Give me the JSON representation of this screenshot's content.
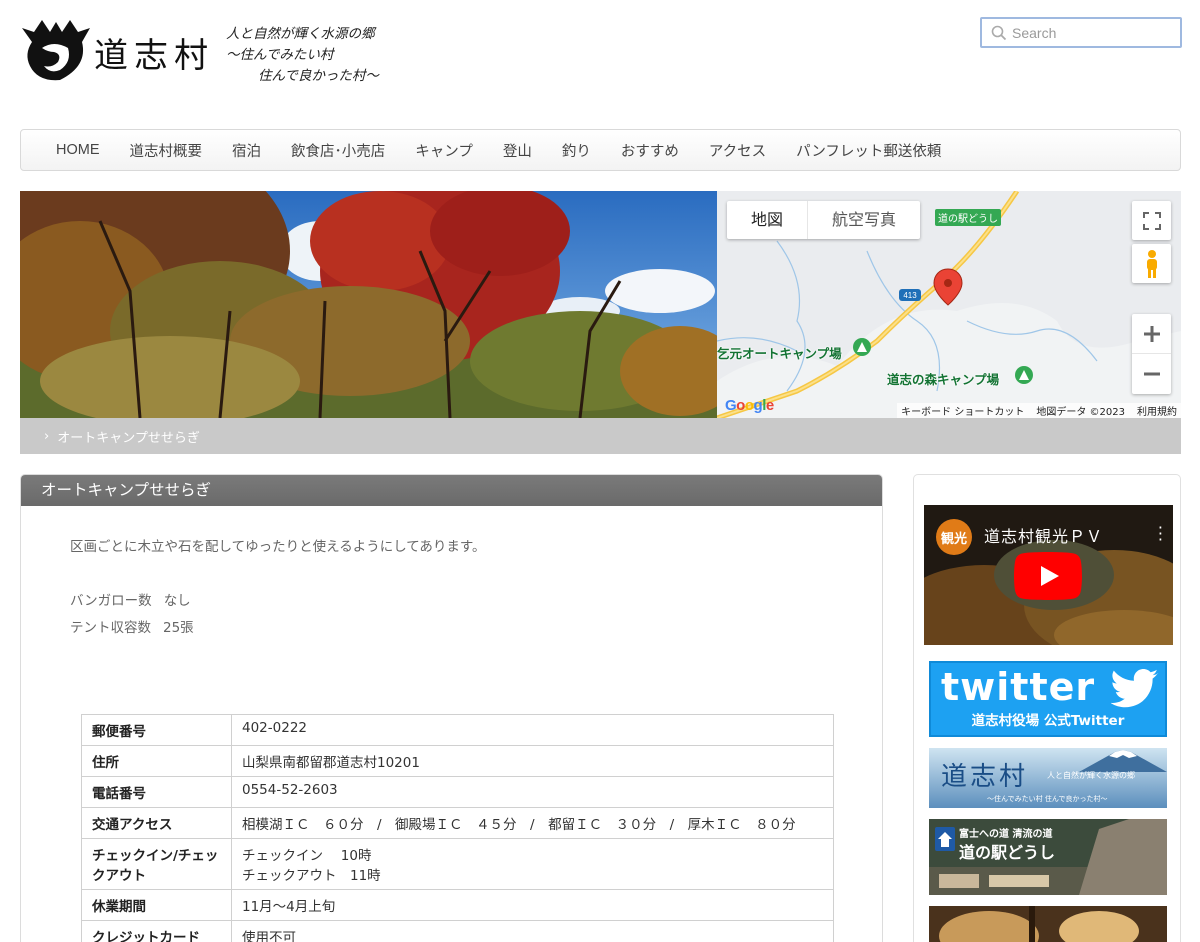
{
  "header": {
    "logo_name": "道志村",
    "tagline": [
      "人と自然が輝く水源の郷",
      "～住んでみたい村",
      "住んで良かった村～"
    ],
    "search_placeholder": "Search"
  },
  "nav": {
    "items": [
      "HOME",
      "道志村概要",
      "宿泊",
      "飲食店･小売店",
      "キャンプ",
      "登山",
      "釣り",
      "おすすめ",
      "アクセス",
      "パンフレット郵送依頼"
    ]
  },
  "map": {
    "type_map": "地図",
    "type_aerial": "航空写真",
    "badge": "道の駅どうし",
    "route_number": "413",
    "labels": [
      "乞元オートキャンプ場",
      "道志の森キャンプ場"
    ],
    "google": "Google",
    "attribution": [
      "キーボード ショートカット",
      "地図データ ©2023",
      "利用規約"
    ]
  },
  "breadcrumb": {
    "current": "オートキャンプせせらぎ"
  },
  "main": {
    "title": "オートキャンプせせらぎ",
    "description": "区画ごとに木立や石を配してゆったりと使えるようにしてあります。",
    "specs": [
      {
        "label": "バンガロー数",
        "value": "なし"
      },
      {
        "label": "テント収容数",
        "value": "25張"
      }
    ],
    "table": [
      {
        "key": "郵便番号",
        "value": "402-0222"
      },
      {
        "key": "住所",
        "value": "山梨県南都留郡道志村10201"
      },
      {
        "key": "電話番号",
        "value": "0554-52-2603"
      },
      {
        "key": "交通アクセス",
        "value": "相模湖ＩＣ　６０分　/　御殿場ＩＣ　４５分　/　都留ＩＣ　３０分　/　厚木ＩＣ　８０分"
      },
      {
        "key": "チェックイン/チェックアウト",
        "value": "チェックイン　 10時",
        "value2": "チェックアウト　11時"
      },
      {
        "key": "休業期間",
        "value": "11月～4月上旬"
      },
      {
        "key": "クレジットカード",
        "value": "使用不可"
      }
    ]
  },
  "sidebar": {
    "video_badge": "観光",
    "video_title": "道志村観光ＰＶ",
    "twitter_word": "twitter",
    "twitter_sub": "道志村役場  公式Twitter",
    "doshi_name": "道志村",
    "doshi_tag": "人と自然が輝く水源の郷",
    "doshi_sub": "～住んでみたい村  住んで良かった村～",
    "michinoeki_small": "富士への道 清流の道",
    "michinoeki_big": "道の駅どうし"
  },
  "colors": {
    "nav_border": "#d9d9d9",
    "breadcrumb_bg": "#c9c9c9",
    "panel_header": "#707070",
    "twitter": "#1da1f2",
    "map_pin": "#ea4335",
    "camp_icon": "#34a853"
  }
}
